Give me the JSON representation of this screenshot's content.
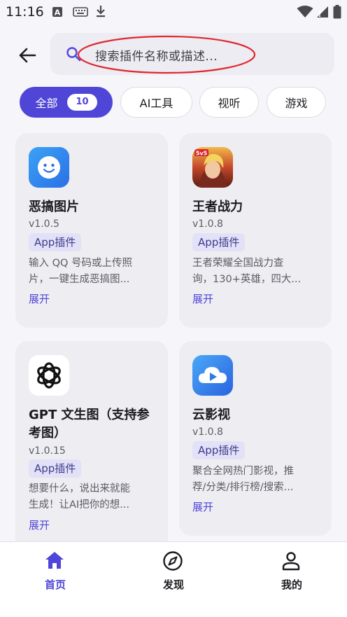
{
  "status_bar": {
    "time": "11:16"
  },
  "search": {
    "placeholder": "搜索插件名称或描述..."
  },
  "chips": [
    {
      "label": "全部",
      "count": "10",
      "active": true
    },
    {
      "label": "AI工具"
    },
    {
      "label": "视听"
    },
    {
      "label": "游戏"
    }
  ],
  "cards": [
    {
      "title": "恶搞图片",
      "version": "v1.0.5",
      "tag": "App插件",
      "desc_line1": "输入 QQ 号码或上传照",
      "desc_line2": "片，一键生成恶搞图...",
      "expand": "展开",
      "icon": "smiley-icon"
    },
    {
      "title": "王者战力",
      "version": "v1.0.8",
      "tag": "App插件",
      "desc_line1": "王者荣耀全国战力查",
      "desc_line2": "询，130+英雄，四大...",
      "expand": "展开",
      "icon": "game-hero-icon"
    },
    {
      "title_line1": "GPT 文生图（支持参",
      "title_line2": "考图）",
      "version": "v1.0.15",
      "tag": "App插件",
      "desc_line1": "想要什么，说出来就能",
      "desc_line2": "生成！让AI把你的想...",
      "expand": "展开",
      "icon": "openai-icon"
    },
    {
      "title": "云影视",
      "version": "v1.0.8",
      "tag": "App插件",
      "desc_line1": "聚合全网热门影视，推",
      "desc_line2": "荐/分类/排行榜/搜索...",
      "expand": "展开",
      "icon": "cloud-play-icon"
    }
  ],
  "nav": [
    {
      "label": "首页",
      "icon": "home-icon",
      "active": true
    },
    {
      "label": "发现",
      "icon": "compass-icon"
    },
    {
      "label": "我的",
      "icon": "person-icon"
    }
  ],
  "colors": {
    "accent": "#4f46d8",
    "annotation": "#e0282e",
    "card_bg": "#ededf2"
  }
}
